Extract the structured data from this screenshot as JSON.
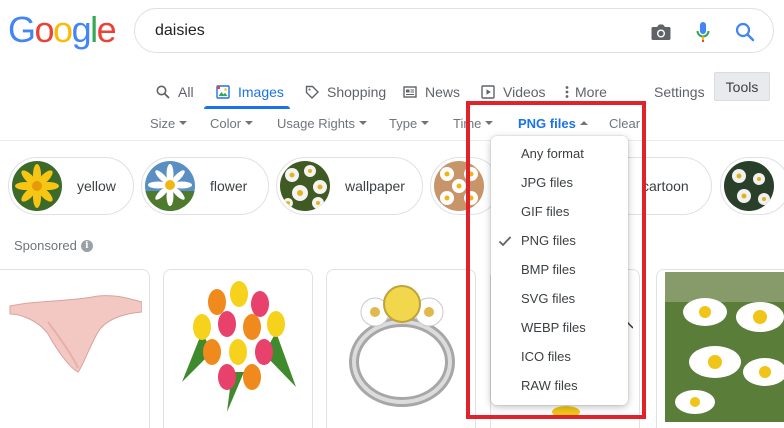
{
  "logo": {
    "text": "Google",
    "colors": [
      "#4285f4",
      "#ea4335",
      "#fbbc05",
      "#4285f4",
      "#34a853",
      "#ea4335"
    ]
  },
  "search": {
    "query": "daisies",
    "icons": [
      "camera-icon",
      "microphone-icon",
      "search-icon"
    ]
  },
  "tabs": [
    {
      "label": "All",
      "icon": "search-icon",
      "active": false
    },
    {
      "label": "Images",
      "icon": "image-icon",
      "active": true
    },
    {
      "label": "Shopping",
      "icon": "tag-icon",
      "active": false
    },
    {
      "label": "News",
      "icon": "newspaper-icon",
      "active": false
    },
    {
      "label": "Videos",
      "icon": "play-icon",
      "active": false
    },
    {
      "label": "More",
      "icon": "vertical-dots-icon",
      "active": false
    }
  ],
  "settings_label": "Settings",
  "tools_label": "Tools",
  "filters": [
    {
      "label": "Size"
    },
    {
      "label": "Color"
    },
    {
      "label": "Usage Rights"
    },
    {
      "label": "Type"
    },
    {
      "label": "Time"
    },
    {
      "label": "PNG files",
      "active": true
    },
    {
      "label": "Clear"
    }
  ],
  "chips": [
    {
      "label": "yellow"
    },
    {
      "label": "flower"
    },
    {
      "label": "wallpaper"
    },
    {
      "label": ""
    },
    {
      "label": "cartoon"
    },
    {
      "label": ""
    }
  ],
  "sponsored_label": "Sponsored",
  "dropdown": {
    "items": [
      {
        "label": "Any format",
        "selected": false
      },
      {
        "label": "JPG files",
        "selected": false
      },
      {
        "label": "GIF files",
        "selected": false
      },
      {
        "label": "PNG files",
        "selected": true
      },
      {
        "label": "BMP files",
        "selected": false
      },
      {
        "label": "SVG files",
        "selected": false
      },
      {
        "label": "WEBP files",
        "selected": false
      },
      {
        "label": "ICO files",
        "selected": false
      },
      {
        "label": "RAW files",
        "selected": false
      }
    ]
  },
  "colors": {
    "accent": "#1a73e8",
    "highlight": "#e0232b",
    "muted": "#70757a"
  }
}
